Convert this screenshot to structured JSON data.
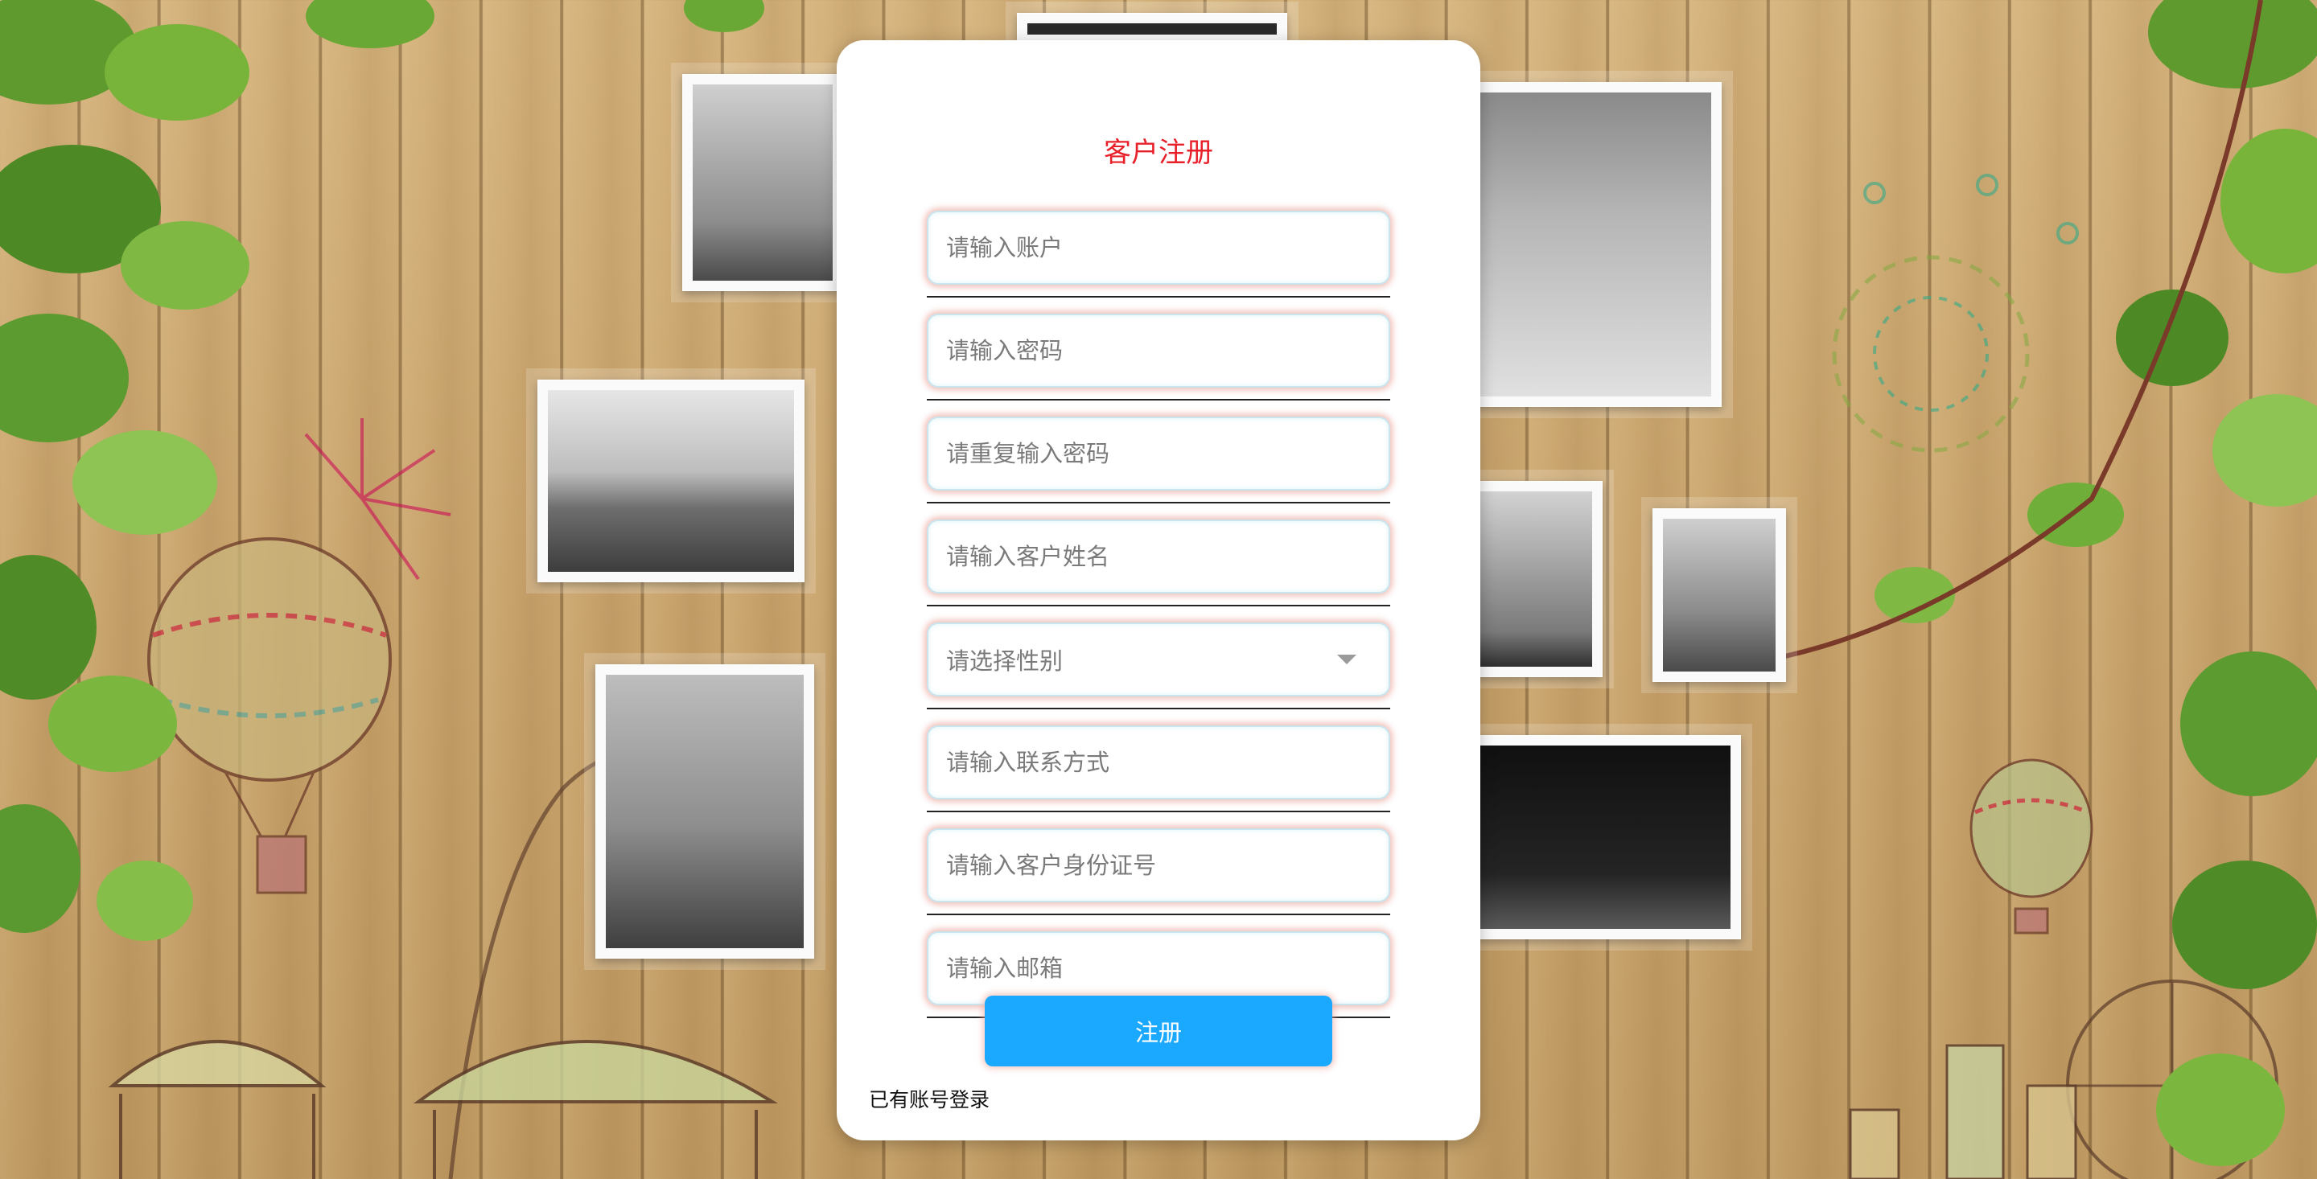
{
  "form": {
    "title": "客户注册",
    "fields": [
      {
        "placeholder": "请输入账户"
      },
      {
        "placeholder": "请输入密码"
      },
      {
        "placeholder": "请重复输入密码"
      },
      {
        "placeholder": "请输入客户姓名"
      },
      {
        "placeholder": "请选择性别"
      },
      {
        "placeholder": "请输入联系方式"
      },
      {
        "placeholder": "请输入客户身份证号"
      },
      {
        "placeholder": "请输入邮箱"
      }
    ],
    "submit_label": "注册",
    "login_link": "已有账号登录"
  },
  "background": {
    "image": "wooden-wall-with-photos-and-vines",
    "accent_colors": {
      "title": "#e8202a",
      "button": "#1ba8ff"
    }
  }
}
